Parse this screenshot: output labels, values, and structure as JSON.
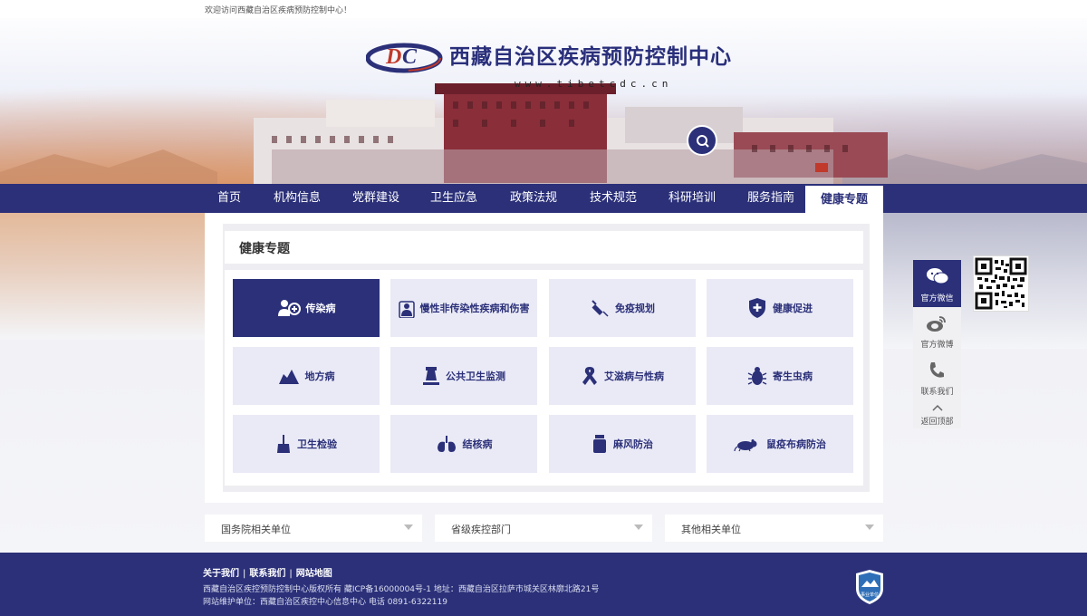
{
  "topbar": {
    "welcome": "欢迎访问西藏自治区疾病预防控制中心！"
  },
  "logo": {
    "title": "西藏自治区疾病预防控制中心",
    "url": "www.tibetcdc.cn"
  },
  "nav": {
    "items": [
      {
        "label": "首页"
      },
      {
        "label": "机构信息"
      },
      {
        "label": "党群建设"
      },
      {
        "label": "卫生应急"
      },
      {
        "label": "政策法规"
      },
      {
        "label": "技术规范"
      },
      {
        "label": "科研培训"
      },
      {
        "label": "服务指南"
      },
      {
        "label": "健康专题"
      }
    ],
    "active": "健康专题"
  },
  "section": {
    "title": "健康专题"
  },
  "tiles": [
    {
      "label": "传染病",
      "icon": "doctor-plus-icon",
      "active": true
    },
    {
      "label": "慢性非传染性疾病和伤害",
      "icon": "person-icon",
      "active": false
    },
    {
      "label": "免疫规划",
      "icon": "syringe-icon",
      "active": false
    },
    {
      "label": "健康促进",
      "icon": "shield-plus-icon",
      "active": false
    },
    {
      "label": "地方病",
      "icon": "mountain-icon",
      "active": false
    },
    {
      "label": "公共卫生监测",
      "icon": "microscope-icon",
      "active": false
    },
    {
      "label": "艾滋病与性病",
      "icon": "ribbon-icon",
      "active": false
    },
    {
      "label": "寄生虫病",
      "icon": "bug-icon",
      "active": false
    },
    {
      "label": "卫生检验",
      "icon": "brush-icon",
      "active": false
    },
    {
      "label": "结核病",
      "icon": "lungs-icon",
      "active": false
    },
    {
      "label": "麻风防治",
      "icon": "bottle-icon",
      "active": false
    },
    {
      "label": "鼠疫布病防治",
      "icon": "rat-icon",
      "active": false
    }
  ],
  "dropdowns": [
    {
      "label": "国务院相关单位"
    },
    {
      "label": "省级疾控部门"
    },
    {
      "label": "其他相关单位"
    }
  ],
  "side": {
    "wechat": "官方微信",
    "weibo": "官方微博",
    "contact": "联系我们",
    "top": "返回顶部"
  },
  "footer": {
    "link_about": "关于我们",
    "link_contact": "联系我们",
    "link_sitemap": "网站地图",
    "sep": "|",
    "line1": "西藏自治区疾控预防控制中心版权所有  藏ICP备16000004号-1 地址：西藏自治区拉萨市城关区林廓北路21号",
    "line2": "网站维护单位：西藏自治区疾控中心信息中心  电话 0891-6322119",
    "badge": "事业单位"
  },
  "colors": {
    "brand": "#2b3079",
    "tile_bg": "#eaeaf6"
  }
}
